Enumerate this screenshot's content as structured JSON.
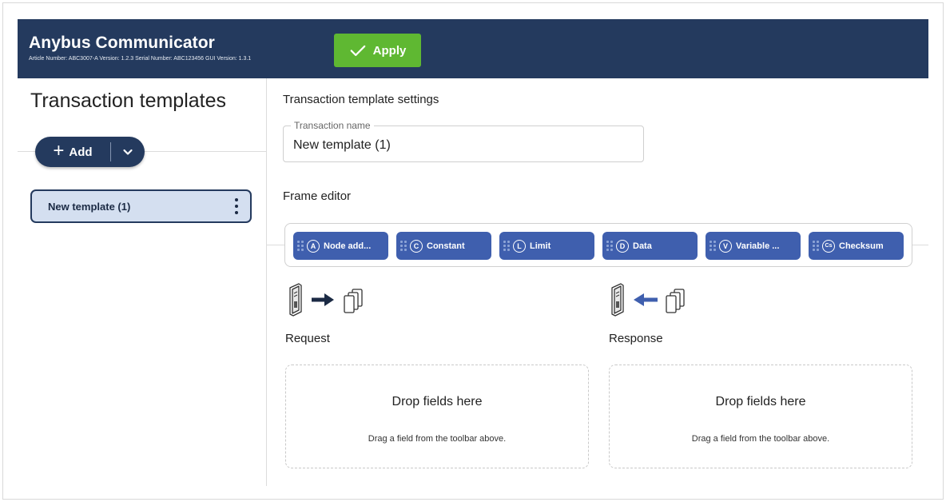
{
  "header": {
    "app_title": "Anybus Communicator",
    "meta": "Article Number: ABC3007-A Version: 1.2.3 Serial Number: ABC123456 GUI Version: 1.3.1",
    "apply_label": "Apply",
    "colors": {
      "bar": "#243a5e",
      "apply": "#5fb832"
    }
  },
  "sidebar": {
    "title": "Transaction templates",
    "add_label": "Add",
    "items": [
      {
        "label": "New template (1)"
      }
    ]
  },
  "main": {
    "settings_title": "Transaction template settings",
    "transaction_name": {
      "label": "Transaction name",
      "value": "New template (1)"
    },
    "frame_editor_title": "Frame editor",
    "fields": [
      {
        "badge": "A",
        "label": "Node add..."
      },
      {
        "badge": "C",
        "label": "Constant"
      },
      {
        "badge": "L",
        "label": "Limit"
      },
      {
        "badge": "D",
        "label": "Data"
      },
      {
        "badge": "V",
        "label": "Variable ..."
      },
      {
        "badge": "Cs",
        "label": "Checksum"
      }
    ],
    "request": {
      "label": "Request",
      "drop_title": "Drop fields here",
      "drop_hint": "Drag a field from the toolbar above."
    },
    "response": {
      "label": "Response",
      "drop_title": "Drop fields here",
      "drop_hint": "Drag a field from the toolbar above."
    }
  }
}
